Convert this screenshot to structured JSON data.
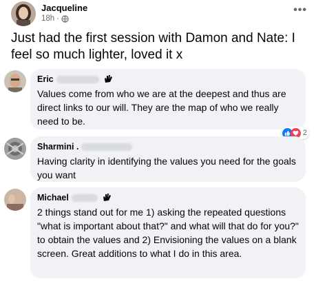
{
  "post": {
    "author": "Jacqueline",
    "time": "18h",
    "more_label": "•••",
    "text": "Just had the first session with Damon and Nate: I feel so much lighter, loved it x"
  },
  "comments": [
    {
      "name": "Eric",
      "text": "Values come from who we are at the deepest and thus are direct links to our will. They are the map of who we really need to be.",
      "reaction_count": "2"
    },
    {
      "name": "Sharmini .",
      "text": "Having clarity in identifying the values you need for the goals you want"
    },
    {
      "name": "Michael",
      "text": "2 things stand out for me 1) asking the repeated questions \"what is important about that?\" and what will that do for you?\" to obtain the values and 2) Envisioning the values on a blank screen. Great additions to what I do in this area."
    }
  ],
  "colors": {
    "bubble": "#f0f2f5",
    "meta": "#65676b",
    "like": "#1877f2",
    "love": "#f33e58"
  },
  "icons": [
    "globe-icon",
    "more-options-icon",
    "waving-hand-icon",
    "like-reaction-icon",
    "love-reaction-icon"
  ]
}
